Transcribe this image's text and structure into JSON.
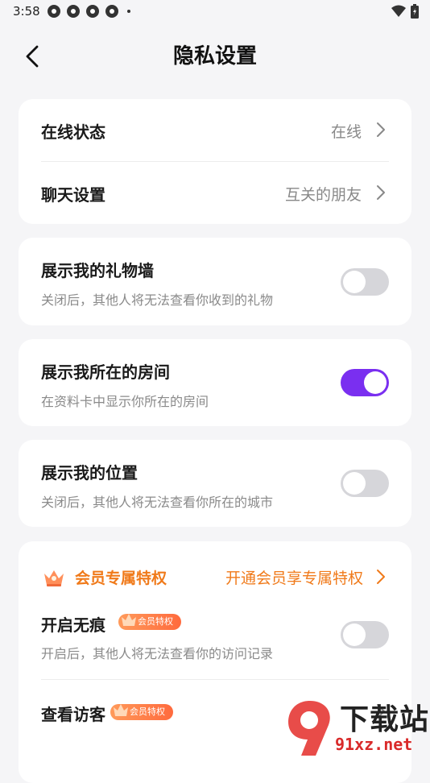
{
  "status_bar": {
    "time": "3:58"
  },
  "header": {
    "title": "隐私设置"
  },
  "general": {
    "online_status": {
      "label": "在线状态",
      "value": "在线"
    },
    "chat_settings": {
      "label": "聊天设置",
      "value": "互关的朋友"
    }
  },
  "toggles": {
    "gift_wall": {
      "label": "展示我的礼物墙",
      "desc": "关闭后，其他人将无法查看你收到的礼物",
      "on": false
    },
    "room": {
      "label": "展示我所在的房间",
      "desc": "在资料卡中显示你所在的房间",
      "on": true
    },
    "location": {
      "label": "展示我的位置",
      "desc": "关闭后，其他人将无法查看你所在的城市",
      "on": false
    }
  },
  "vip": {
    "title": "会员专属特权",
    "link": "开通会员享专属特权",
    "badge": "会员特权",
    "incognito": {
      "label": "开启无痕",
      "desc": "开启后，其他人将无法查看你的访问记录",
      "on": false
    },
    "visitors": {
      "label": "查看访客"
    }
  },
  "watermark": {
    "big": "下载站",
    "small": "91xz.net"
  },
  "colors": {
    "accent": "#7a2ff0",
    "vip": "#f07a1a",
    "background": "#f5f5f7"
  }
}
